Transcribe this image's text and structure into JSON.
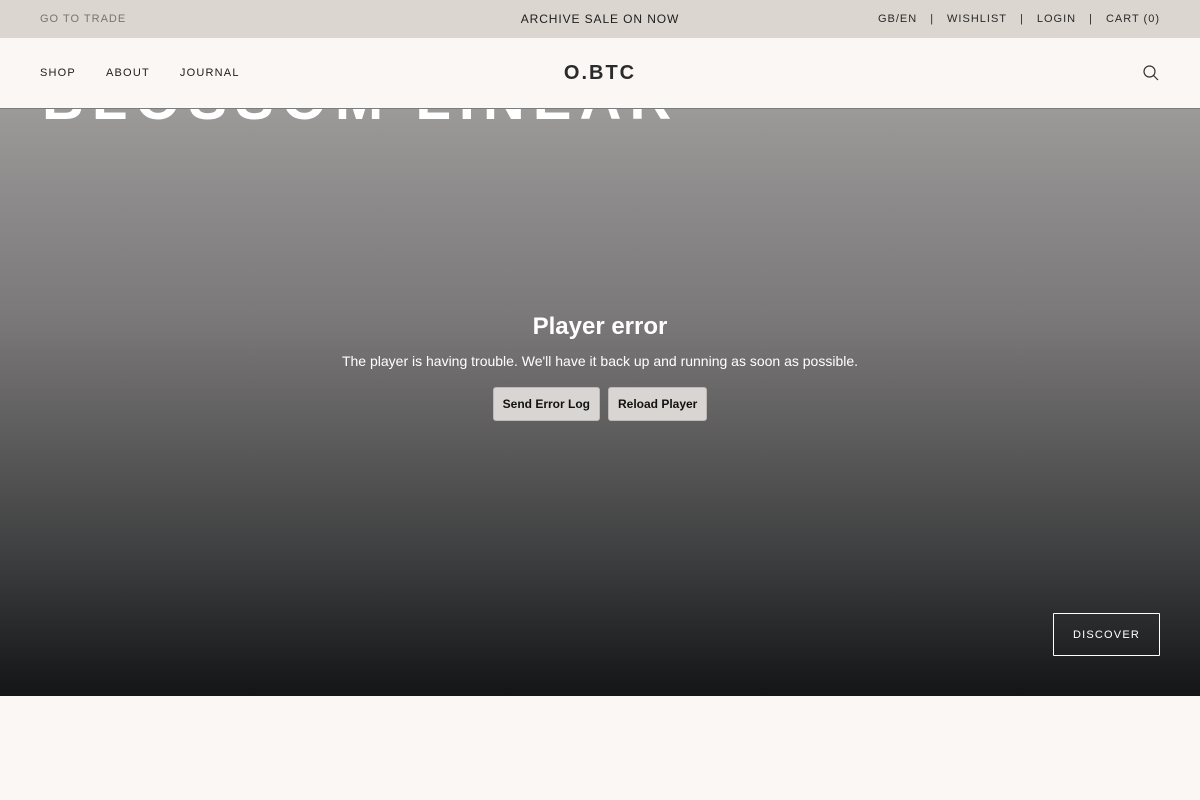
{
  "topbar": {
    "go_to_trade": "GO TO TRADE",
    "announcement": "ARCHIVE SALE ON NOW",
    "region": "GB/EN",
    "separator": "|",
    "wishlist": "WISHLIST",
    "login": "LOGIN",
    "cart": "CART (0)"
  },
  "header": {
    "nav": [
      "SHOP",
      "ABOUT",
      "JOURNAL"
    ],
    "logo": "O.BTC",
    "search_icon": "search-icon"
  },
  "hero": {
    "title": "BLOSSOM LINEAR",
    "player_error": {
      "title": "Player error",
      "message": "The player is having trouble. We'll have it back up and running as soon as possible.",
      "send_log": "Send Error Log",
      "reload": "Reload Player"
    },
    "discover": "DISCOVER"
  },
  "colors": {
    "topbar_bg": "#dbd6d0",
    "page_bg": "#fbf7f4",
    "text_dark": "#1d1d1d"
  }
}
